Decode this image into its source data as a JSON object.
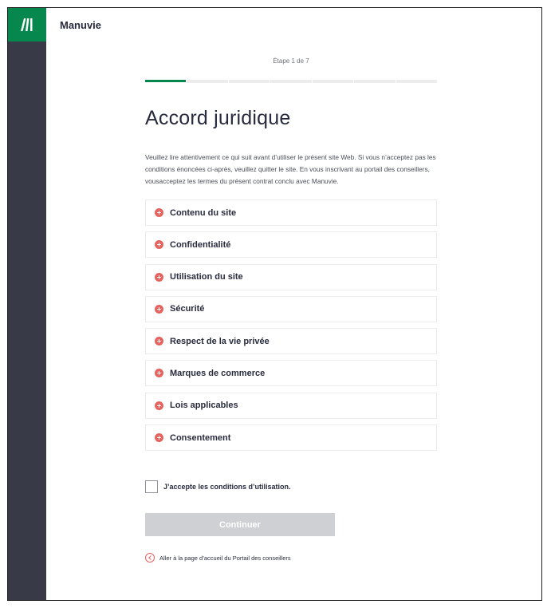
{
  "brand": {
    "name": "Manuvie"
  },
  "progress": {
    "label": "Étape 1 de 7",
    "current_step": 1,
    "total_steps": 7
  },
  "page": {
    "title": "Accord juridique",
    "intro": "Veuillez lire attentivement ce qui suit avant d’utiliser le présent site Web. Si vous n’acceptez pas les conditions énoncées ci-après, veuillez quitter le site. En vous inscrivant au portail des conseillers, vousacceptez les termes du présent contrat conclu avec Manuvie."
  },
  "sections": [
    {
      "label": "Contenu du site"
    },
    {
      "label": "Confidentialité"
    },
    {
      "label": "Utilisation du site"
    },
    {
      "label": "Sécurité"
    },
    {
      "label": "Respect de la vie privée"
    },
    {
      "label": "Marques de commerce"
    },
    {
      "label": "Lois applicables"
    },
    {
      "label": "Consentement"
    }
  ],
  "accept": {
    "label": "J’accepte les conditions d’utilisation.",
    "checked": false
  },
  "continue_button": {
    "label": "Continuer",
    "enabled": false
  },
  "back_link": {
    "label": "Aller à la page d’accueil du Portail des conseillers"
  },
  "colors": {
    "brand_green": "#06874e",
    "sidebar": "#383a47",
    "accent_coral": "#e6645f",
    "disabled_button": "#cfd0d3"
  }
}
